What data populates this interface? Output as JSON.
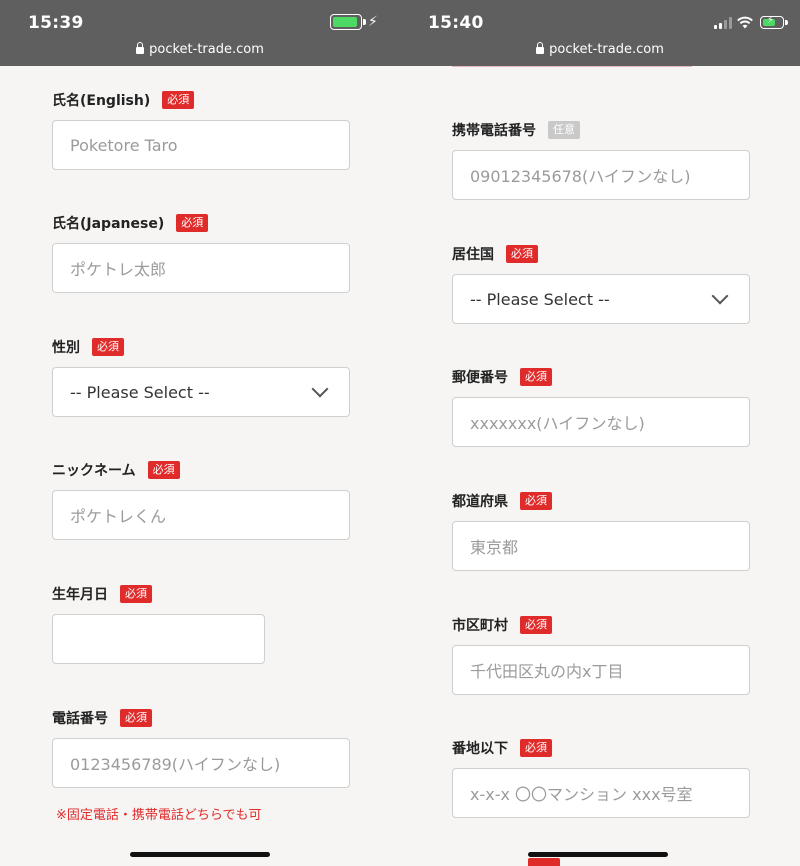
{
  "left": {
    "status": {
      "time": "15:39",
      "url": "pocket-trade.com"
    },
    "fields": [
      {
        "label": "氏名(English)",
        "badge": "必須",
        "placeholder": "Poketore Taro"
      },
      {
        "label": "氏名(Japanese)",
        "badge": "必須",
        "placeholder": "ポケトレ太郎"
      },
      {
        "label": "性別",
        "badge": "必須",
        "value": "-- Please Select --"
      },
      {
        "label": "ニックネーム",
        "badge": "必須",
        "placeholder": "ポケトレくん"
      },
      {
        "label": "生年月日",
        "badge": "必須",
        "placeholder": ""
      },
      {
        "label": "電話番号",
        "badge": "必須",
        "placeholder": "0123456789(ハイフンなし)"
      }
    ],
    "note": "※固定電話・携帯電話どちらでも可"
  },
  "right": {
    "status": {
      "time": "15:40",
      "url": "pocket-trade.com"
    },
    "fields": [
      {
        "label": "携帯電話番号",
        "badge": "任意",
        "placeholder": "09012345678(ハイフンなし)"
      },
      {
        "label": "居住国",
        "badge": "必須",
        "value": "-- Please Select --"
      },
      {
        "label": "郵便番号",
        "badge": "必須",
        "placeholder": "xxxxxxx(ハイフンなし)"
      },
      {
        "label": "都道府県",
        "badge": "必須",
        "placeholder": "東京都"
      },
      {
        "label": "市区町村",
        "badge": "必須",
        "placeholder": "千代田区丸の内x丁目"
      },
      {
        "label": "番地以下",
        "badge": "必須",
        "placeholder": "x-x-x 〇〇マンション xxx号室"
      }
    ]
  },
  "colors": {
    "required_badge": "#e02b2b",
    "optional_badge": "#c9c9c9",
    "status_bar": "#5f5f5f",
    "battery_green": "#4cd964"
  },
  "icons": {
    "lock": "lock-icon",
    "battery": "battery-icon",
    "charging": "bolt-icon",
    "signal": "signal-icon",
    "wifi": "wifi-icon",
    "chevron": "chevron-down-icon"
  }
}
